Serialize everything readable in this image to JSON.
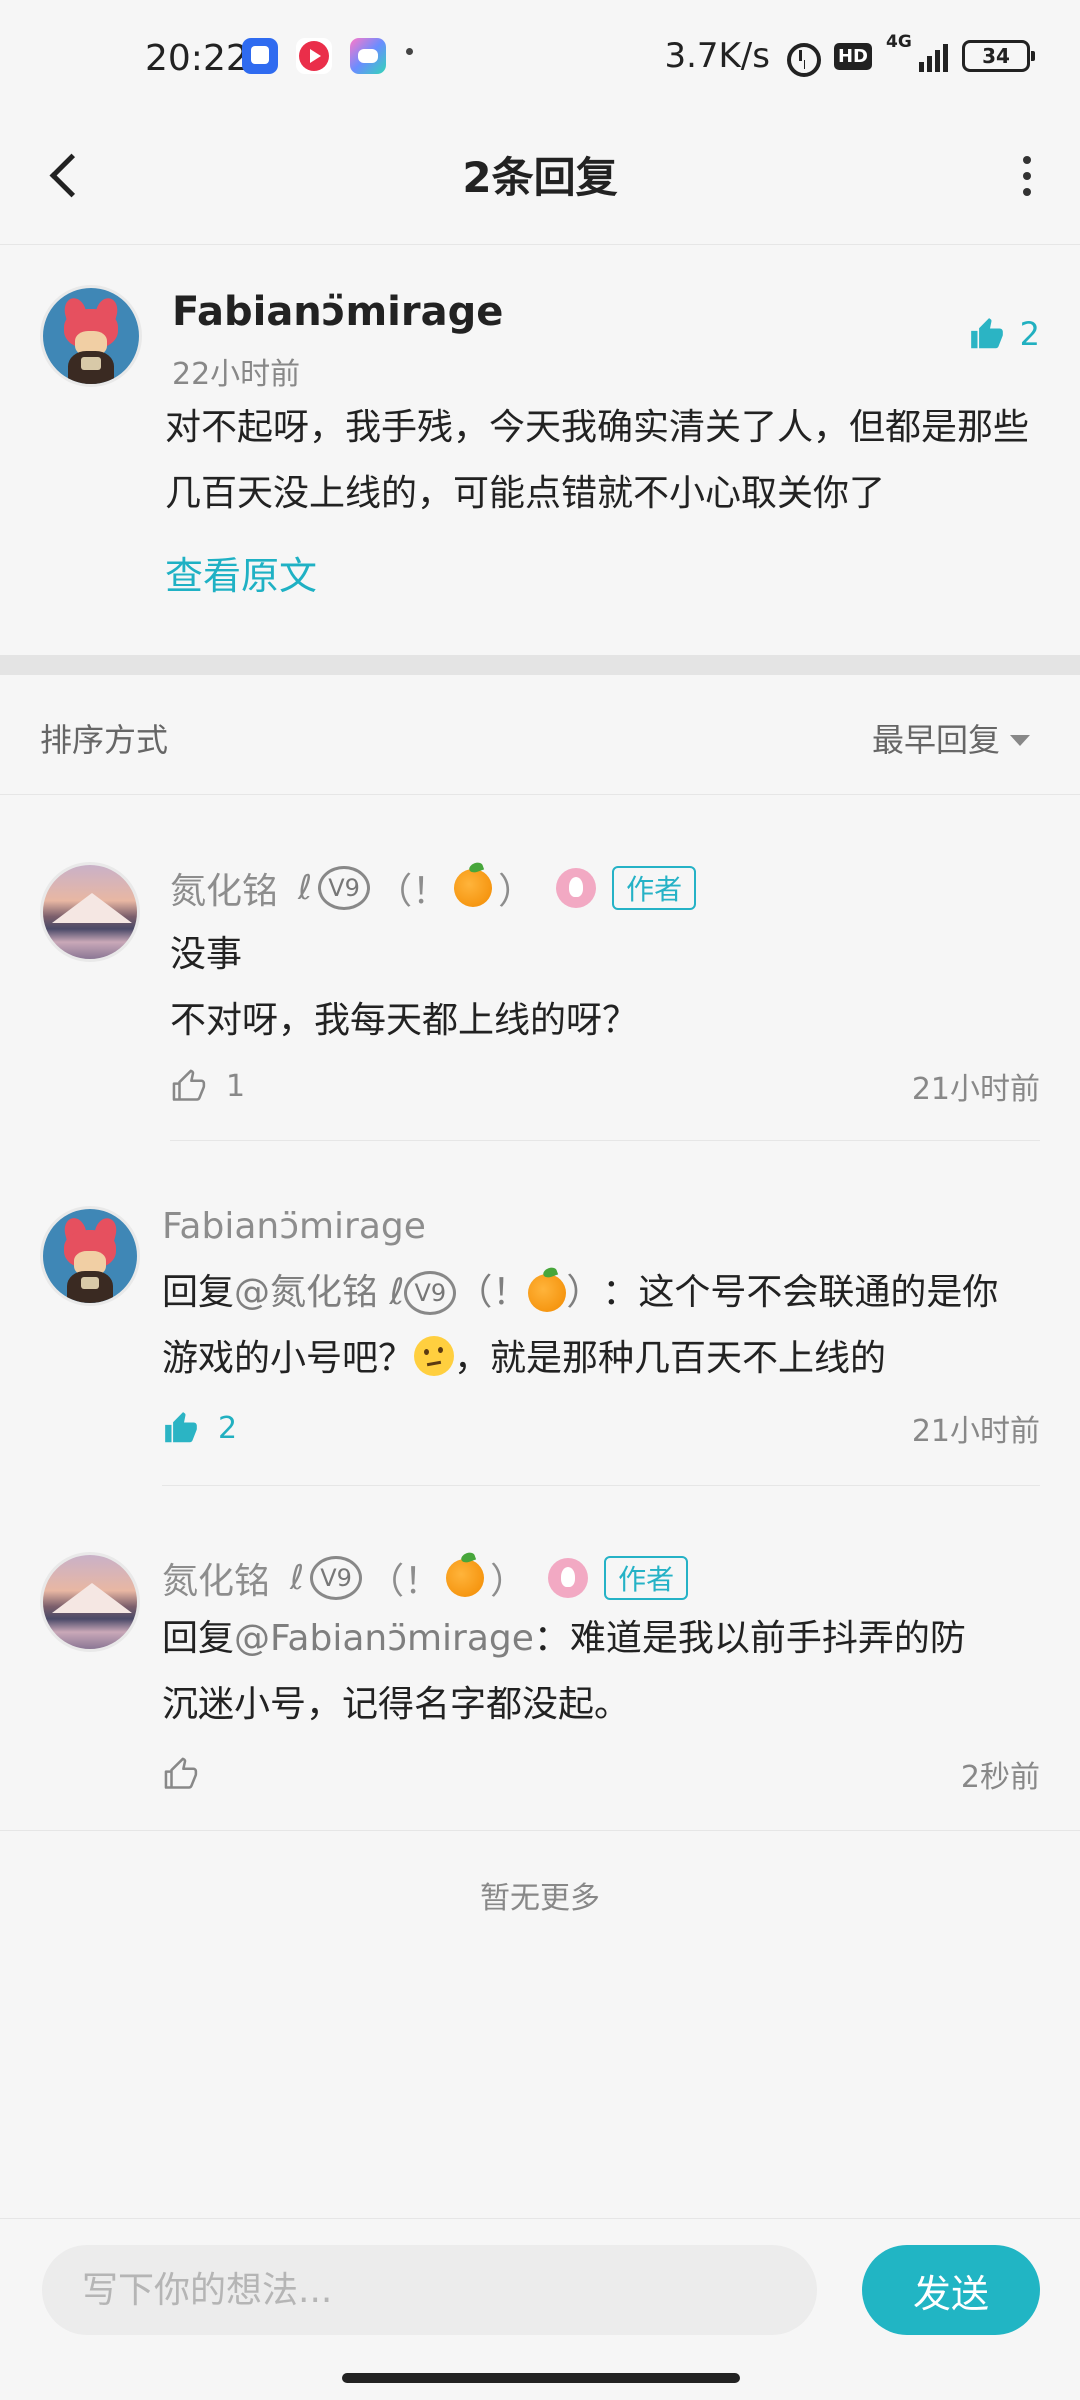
{
  "status_bar": {
    "time": "20:22",
    "net_speed": "3.7K/s",
    "hd": "HD",
    "network": "4G",
    "battery": "34"
  },
  "header": {
    "title": "2条回复"
  },
  "main_comment": {
    "author": "Fabianↄ̈mirage",
    "time": "22小时前",
    "likes": "2",
    "text": "对不起呀，我手残，今天我确实清关了人，但都是那些几百天没上线的，可能点错就不小心取关你了",
    "view_original": "查看原文"
  },
  "sort": {
    "label": "排序方式",
    "value": "最早回复"
  },
  "replies": [
    {
      "author": "氮化铭",
      "author_suffix_glyph": "ℓ",
      "v_badge": "V9",
      "paren_open": "（！",
      "paren_close": "）",
      "author_tag": "作者",
      "lines": [
        "没事",
        "不对呀，我每天都上线的呀？"
      ],
      "likes": "1",
      "time": "21小时前"
    },
    {
      "author": "Fabianↄ̈mirage",
      "reply_prefix": "回复",
      "mention": "@氮化铭 ℓ",
      "mention_badge": "V9",
      "mention_paren_open": "（！",
      "mention_paren_close": "）",
      "text_after_mention": "：这个号不会联通的是你",
      "text_line2_before": "游戏的小号吧？",
      "text_line2_after": "，就是那种几百天不上线的",
      "likes": "2",
      "time": "21小时前"
    },
    {
      "author": "氮化铭",
      "author_suffix_glyph": "ℓ",
      "v_badge": "V9",
      "paren_open": "（！",
      "paren_close": "）",
      "author_tag": "作者",
      "reply_prefix": "回复",
      "mention": "@Fabianↄ̈mirage",
      "text_after_mention": "：难道是我以前手抖弄的防",
      "text_line2": "沉迷小号，记得名字都没起。",
      "time": "2秒前"
    }
  ],
  "footer": {
    "no_more": "暂无更多",
    "input_placeholder": "写下你的想法...",
    "send_label": "发送"
  },
  "colors": {
    "accent": "#21b5c4",
    "background": "#f6f6f6",
    "separator": "#e4e4e4"
  },
  "icons": [
    "back-arrow-icon",
    "more-vert-icon",
    "thumb-up-icon",
    "thumb-up-outline-icon",
    "caret-down-icon",
    "orange-emoji-icon",
    "pink-bunny-badge-icon",
    "thinking-face-emoji-icon",
    "alarm-icon",
    "battery-icon",
    "signal-icon"
  ]
}
